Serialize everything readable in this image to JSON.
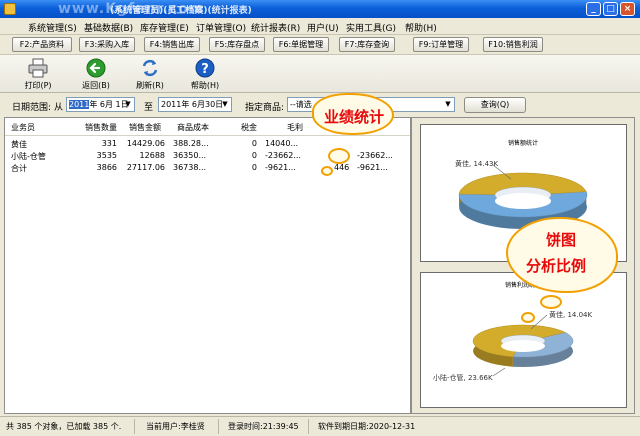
{
  "window": {
    "title": "(系统管理员)(员工档案)(统计报表)",
    "watermark": "www.Kgfanr.com",
    "buttons": [
      "_",
      "□",
      "×"
    ]
  },
  "menu": [
    "系统管理(S)",
    "基础数据(B)",
    "库存管理(E)",
    "订单管理(O)",
    "统计报表(R)",
    "用户(U)",
    "实用工具(G)",
    "帮助(H)"
  ],
  "quickbar": [
    "F2:产品资料",
    "F3:采购入库",
    "F4:销售出库",
    "F5:库存盘点",
    "F6:单据管理",
    "F7:库存查询",
    "F9:订单管理",
    "F10:销售利润"
  ],
  "toolbar": {
    "print": "打印(P)",
    "back": "返回(B)",
    "refresh": "刷新(R)",
    "help": "帮助(H)"
  },
  "filter": {
    "date_range_label": "日期范围:",
    "from_label": "从",
    "start_date_year": "2011",
    "start_date_rest": "年 6月 1日",
    "to_label": "至",
    "end_date": "2011年 6月30日",
    "product_label": "指定商品:",
    "product_value": "--请选",
    "query_button": "查询(Q)"
  },
  "table": {
    "headers": [
      "业务员",
      "销售数量",
      "销售金额",
      "商品成本",
      "税金",
      "毛利"
    ],
    "rows": [
      {
        "name": "黄佳",
        "qty": "331",
        "amount": "14429.06",
        "cost": "388.28...",
        "tax": "0",
        "profit": "14040...",
        "extra": ""
      },
      {
        "name": "小陆-仓管",
        "qty": "3535",
        "amount": "12688",
        "cost": "36350...",
        "tax": "0",
        "profit": "-23662...",
        "extra": "-23662..."
      },
      {
        "name": "合计",
        "qty": "3866",
        "amount": "27117.06",
        "cost": "36738...",
        "tax": "0",
        "profit": "-9621...",
        "extra": "-9621...",
        "extra2": "446"
      }
    ]
  },
  "charts": {
    "chart1_title": "销售额统计",
    "chart1_label": "黄佳, 14.43K",
    "chart2_title": "销售利润统计",
    "chart2_label_a": "黄佳, 14.04K",
    "chart2_label_b": "小陆-仓管, 23.66K"
  },
  "chart_data": [
    {
      "type": "pie",
      "title": "销售额统计",
      "categories": [
        "黄佳",
        "小陆-仓管"
      ],
      "values": [
        14.43,
        12.69
      ],
      "unit": "K",
      "colors": [
        "#6fa8dc",
        "#d4ac2c"
      ]
    },
    {
      "type": "pie",
      "title": "销售利润统计",
      "categories": [
        "黄佳",
        "小陆-仓管"
      ],
      "values": [
        14.04,
        23.66
      ],
      "unit": "K",
      "colors": [
        "#8fb3d6",
        "#d4ac2c"
      ]
    }
  ],
  "callouts": {
    "sales_stats": "业绩统计",
    "pie_line1": "饼图",
    "pie_line2": "分析比例"
  },
  "status": {
    "objects": "共 385 个对象，已加载 385 个.",
    "current_user": "当前用户:李桂贤",
    "login_time": "登录时间:21:39:45",
    "expiry": "软件到期日期:2020-12-31"
  },
  "colors": {
    "titlebar": "#0a5fd8",
    "callout_border": "#f2a000",
    "callout_text": "#e8090b",
    "pie_blue": "#6fa8dc",
    "pie_gold": "#d4ac2c"
  }
}
